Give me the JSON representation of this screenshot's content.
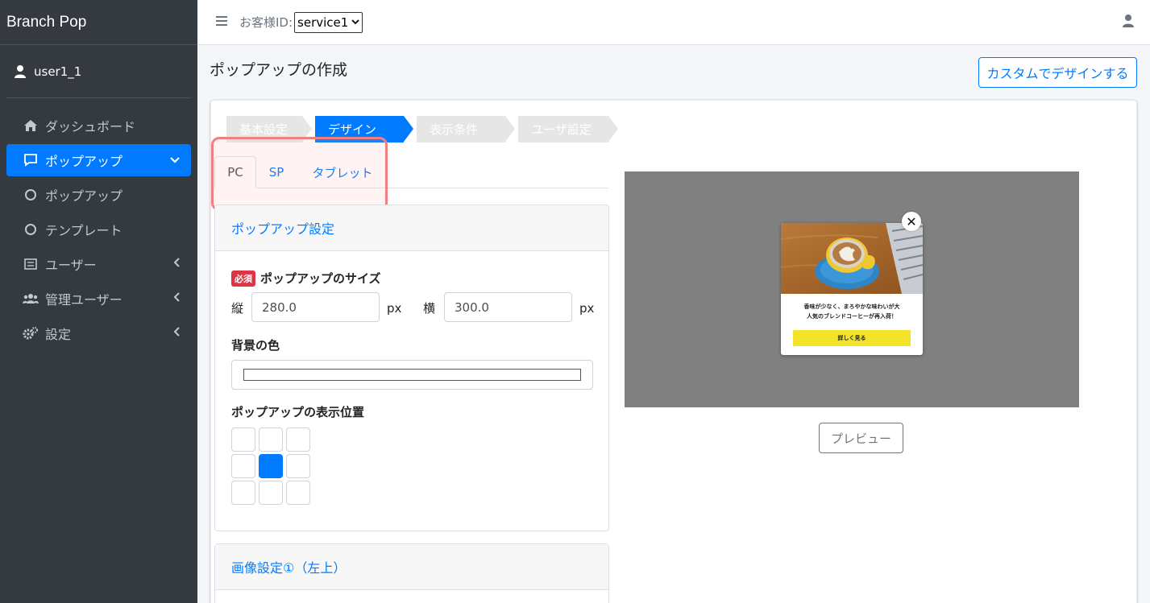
{
  "brand": "Branch Pop",
  "user": {
    "name": "user1_1"
  },
  "sidebar": {
    "items": [
      {
        "label": "ダッシュボード",
        "icon": "home-icon"
      },
      {
        "label": "ポップアップ",
        "icon": "comment-icon",
        "active": true
      },
      {
        "label": "ポップアップ",
        "icon": "circle-icon"
      },
      {
        "label": "テンプレート",
        "icon": "circle-icon"
      },
      {
        "label": "ユーザー",
        "icon": "list-icon"
      },
      {
        "label": "管理ユーザー",
        "icon": "users-icon"
      },
      {
        "label": "設定",
        "icon": "gears-icon"
      }
    ]
  },
  "topbar": {
    "customer_label": "お客様ID:",
    "customer_value": "service1"
  },
  "page": {
    "title": "ポップアップの作成",
    "custom_button": "カスタムでデザインする"
  },
  "steps": [
    "基本設定",
    "デザイン",
    "表示条件",
    "ユーザ設定"
  ],
  "tabs": [
    "PC",
    "SP",
    "タブレット"
  ],
  "popup_settings": {
    "header": "ポップアップ設定",
    "size_badge": "必須",
    "size_label": "ポップアップのサイズ",
    "height_label": "縦",
    "height_value": "280.0",
    "width_label": "横",
    "width_value": "300.0",
    "unit": "px",
    "bg_label": "背景の色",
    "bg_color": "#ffffff",
    "position_label": "ポップアップの表示位置",
    "selected_position": "middle-center"
  },
  "image_settings": {
    "header": "画像設定①（左上）"
  },
  "preview": {
    "popup_text_line1": "香味が少なく、まろやかな味わいが大",
    "popup_text_line2": "人気のブレンドコーヒーが再入荷！",
    "popup_button": "詳しく見る",
    "close_symbol": "✕",
    "button_label": "プレビュー",
    "button_color": "#f2e229"
  },
  "colors": {
    "accent": "#007bff",
    "sidebar": "#343a40"
  }
}
